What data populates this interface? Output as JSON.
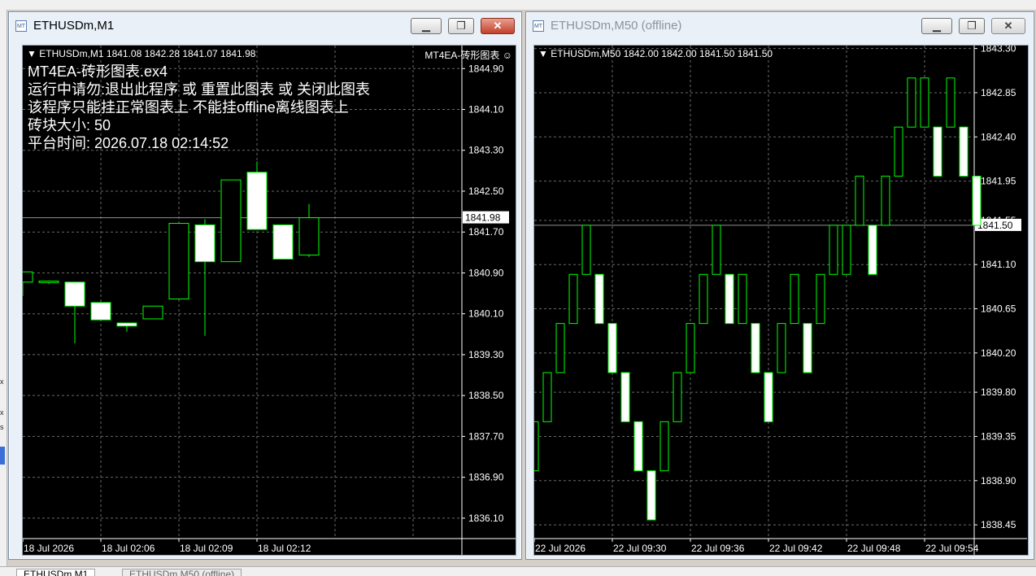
{
  "top_strip_text": "",
  "left_marks": [
    "x",
    "x",
    "s"
  ],
  "win1": {
    "title": "ETHUSDm,M1",
    "info": "ETHUSDm,M1  1841.08 1842.28 1841.07 1841.98",
    "ea_label": "MT4EA-砖形图表",
    "ea_face": "☺",
    "overlay_lines": [
      "MT4EA-砖形图表.ex4",
      "运行中请勿:退出此程序 或 重置此图表 或 关闭此图表",
      "该程序只能挂正常图表上 不能挂offline离线图表上",
      "砖块大小: 50",
      "平台时间:  2026.07.18 02:14:52"
    ],
    "price_labels": [
      "1844.90",
      "1844.10",
      "1843.30",
      "1842.50",
      "1841.70",
      "1840.90",
      "1840.10",
      "1839.30",
      "1838.50",
      "1837.70",
      "1836.90",
      "1836.10"
    ],
    "current_price": "1841.98",
    "time_labels": [
      "18 Jul 2026",
      "18 Jul 02:06",
      "18 Jul 02:09",
      "18 Jul 02:12"
    ],
    "chart_data": {
      "type": "candlestick",
      "ylim": [
        1835.7,
        1845.35
      ],
      "current_price": 1841.98,
      "candles": [
        {
          "o": 1840.72,
          "h": 1840.9,
          "l": 1840.45,
          "c": 1840.92
        },
        {
          "o": 1840.71,
          "h": 1840.75,
          "l": 1840.68,
          "c": 1840.74
        },
        {
          "o": 1840.72,
          "h": 1840.72,
          "l": 1839.52,
          "c": 1840.25
        },
        {
          "o": 1840.32,
          "h": 1840.32,
          "l": 1839.98,
          "c": 1839.98
        },
        {
          "o": 1839.92,
          "h": 1839.92,
          "l": 1839.75,
          "c": 1839.86
        },
        {
          "o": 1840.0,
          "h": 1840.25,
          "l": 1840.0,
          "c": 1840.25
        },
        {
          "o": 1840.39,
          "h": 1841.87,
          "l": 1840.39,
          "c": 1841.87
        },
        {
          "o": 1841.84,
          "h": 1841.95,
          "l": 1839.67,
          "c": 1841.12
        },
        {
          "o": 1841.12,
          "h": 1842.72,
          "l": 1841.12,
          "c": 1842.72
        },
        {
          "o": 1842.87,
          "h": 1843.08,
          "l": 1841.75,
          "c": 1841.75
        },
        {
          "o": 1841.84,
          "h": 1841.84,
          "l": 1841.17,
          "c": 1841.17
        },
        {
          "o": 1841.25,
          "h": 1842.25,
          "l": 1841.21,
          "c": 1841.98
        }
      ]
    }
  },
  "win2": {
    "title": "ETHUSDm,M50 (offline)",
    "info": "ETHUSDm,M50  1842.00 1842.00 1841.50 1841.50",
    "price_labels": [
      "1843.30",
      "1842.85",
      "1842.40",
      "1841.95",
      "1841.55",
      "1841.10",
      "1840.65",
      "1840.20",
      "1839.80",
      "1839.35",
      "1838.90",
      "1838.45"
    ],
    "current_price": "1841.50",
    "time_labels": [
      "22 Jul 2026",
      "22 Jul 09:30",
      "22 Jul 09:36",
      "22 Jul 09:42",
      "22 Jul 09:48",
      "22 Jul 09:54"
    ],
    "chart_data": {
      "type": "renko",
      "brick_size": 0.5,
      "ylim": [
        1838.31,
        1843.33
      ],
      "current_price": 1841.5,
      "bricks": [
        {
          "lo": 1839.0,
          "up": true
        },
        {
          "lo": 1839.5,
          "up": true
        },
        {
          "lo": 1840.0,
          "up": true
        },
        {
          "lo": 1840.5,
          "up": true
        },
        {
          "lo": 1841.0,
          "up": true
        },
        {
          "lo": 1840.5,
          "up": false
        },
        {
          "lo": 1840.0,
          "up": false
        },
        {
          "lo": 1839.5,
          "up": false
        },
        {
          "lo": 1839.0,
          "up": false
        },
        {
          "lo": 1838.5,
          "up": false
        },
        {
          "lo": 1839.0,
          "up": true
        },
        {
          "lo": 1839.5,
          "up": true
        },
        {
          "lo": 1840.0,
          "up": true
        },
        {
          "lo": 1840.5,
          "up": true
        },
        {
          "lo": 1841.0,
          "up": true
        },
        {
          "lo": 1840.5,
          "up": false
        },
        {
          "lo": 1840.5,
          "up": true
        },
        {
          "lo": 1840.0,
          "up": false
        },
        {
          "lo": 1839.5,
          "up": false
        },
        {
          "lo": 1840.0,
          "up": true
        },
        {
          "lo": 1840.5,
          "up": true
        },
        {
          "lo": 1840.0,
          "up": false
        },
        {
          "lo": 1840.5,
          "up": true
        },
        {
          "lo": 1841.0,
          "up": true
        },
        {
          "lo": 1841.0,
          "up": true
        },
        {
          "lo": 1841.5,
          "up": true
        },
        {
          "lo": 1841.0,
          "up": false
        },
        {
          "lo": 1841.5,
          "up": true
        },
        {
          "lo": 1842.0,
          "up": true
        },
        {
          "lo": 1842.5,
          "up": true
        },
        {
          "lo": 1842.5,
          "up": true
        },
        {
          "lo": 1842.0,
          "up": false
        },
        {
          "lo": 1842.5,
          "up": true
        },
        {
          "lo": 1842.0,
          "up": false
        },
        {
          "lo": 1841.5,
          "up": false
        }
      ]
    }
  },
  "tabs": [
    "ETHUSDm,M1",
    "ETHUSDm,M50 (offline)"
  ]
}
